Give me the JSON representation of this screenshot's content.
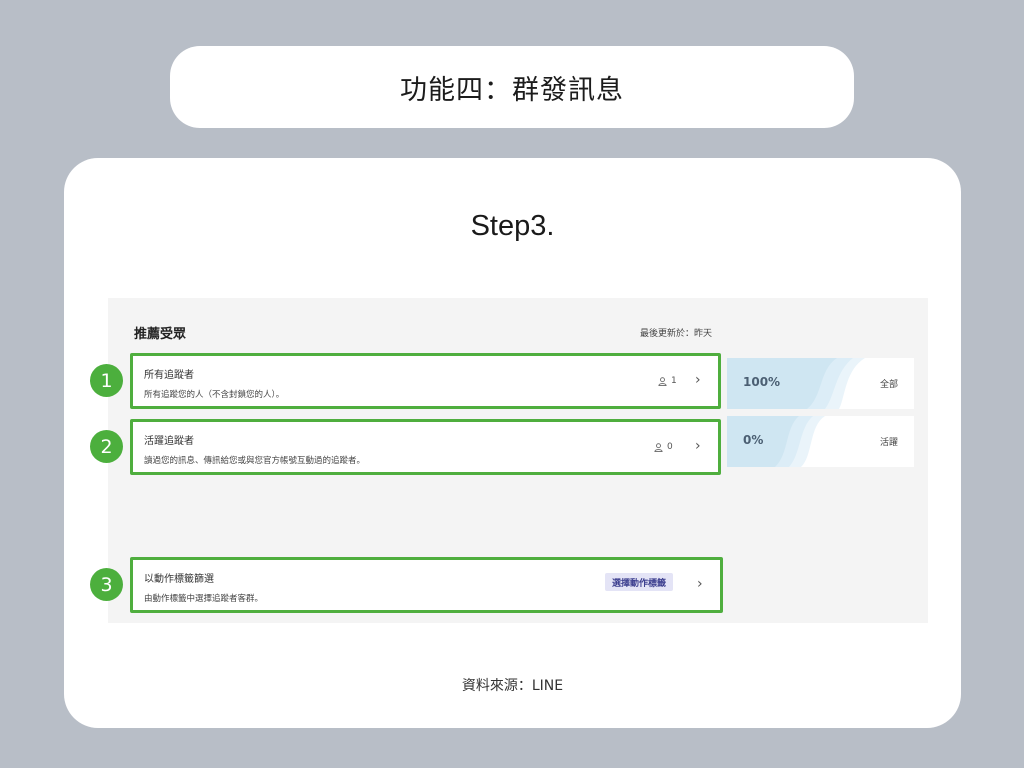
{
  "header": {
    "title": "功能四：群發訊息"
  },
  "card": {
    "step_title": "Step3.",
    "source_caption": "資料來源：LINE"
  },
  "panel": {
    "title": "推薦受眾",
    "updated": "最後更新於：昨天",
    "rows": [
      {
        "number": "1",
        "title": "所有追蹤者",
        "description": "所有追蹤您的人（不含封鎖您的人）。",
        "count": "1",
        "percent": "100%",
        "percent_label": "全部"
      },
      {
        "number": "2",
        "title": "活躍追蹤者",
        "description": "讀過您的訊息、傳訊給您或與您官方帳號互動過的追蹤者。",
        "count": "0",
        "percent": "0%",
        "percent_label": "活躍"
      },
      {
        "number": "3",
        "title": "以動作標籤篩選",
        "description": "由動作標籤中選擇追蹤者客群。",
        "button": "選擇動作標籤"
      }
    ]
  },
  "colors": {
    "highlight": "#4fae3e",
    "number_badge": "#4caf3d",
    "wave": "#cfe6f2",
    "background": "#b8bec7"
  },
  "icons": {
    "count_icon": "person-icon",
    "chevron": "chevron-right-icon"
  }
}
